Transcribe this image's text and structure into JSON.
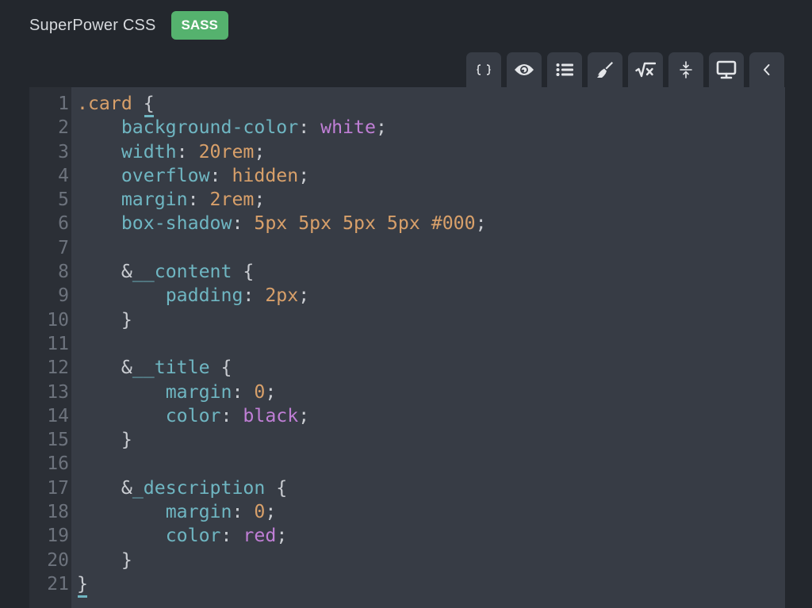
{
  "header": {
    "title": "SuperPower CSS",
    "badge": "SASS"
  },
  "colors": {
    "badge": "#55b26e",
    "property": "#6fb6c2",
    "value": "#d8a06a",
    "keyword": "#c07fd6",
    "background": "#23272d",
    "editor": "#373c45"
  },
  "toolbar": {
    "buttons": [
      {
        "icon": "braces-icon",
        "label": "Format"
      },
      {
        "icon": "eye-icon",
        "label": "Preview"
      },
      {
        "icon": "list-icon",
        "label": "List"
      },
      {
        "icon": "broom-icon",
        "label": "Clean"
      },
      {
        "icon": "square-root-icon",
        "label": "Math"
      },
      {
        "icon": "compress-icon",
        "label": "Collapse"
      },
      {
        "icon": "monitor-icon",
        "label": "Display"
      },
      {
        "icon": "chevron-left-icon",
        "label": "Collapse panel"
      }
    ]
  },
  "editor": {
    "language": "SASS",
    "lines": [
      [
        {
          "t": ".card ",
          "c": "sel"
        },
        {
          "t": "{",
          "c": "punc match"
        }
      ],
      [
        {
          "t": "    "
        },
        {
          "t": "background-color",
          "c": "prop"
        },
        {
          "t": ": ",
          "c": "punc"
        },
        {
          "t": "white",
          "c": "kw"
        },
        {
          "t": ";",
          "c": "punc"
        }
      ],
      [
        {
          "t": "    "
        },
        {
          "t": "width",
          "c": "prop"
        },
        {
          "t": ": ",
          "c": "punc"
        },
        {
          "t": "20rem",
          "c": "num"
        },
        {
          "t": ";",
          "c": "punc"
        }
      ],
      [
        {
          "t": "    "
        },
        {
          "t": "overflow",
          "c": "prop"
        },
        {
          "t": ": ",
          "c": "punc"
        },
        {
          "t": "hidden",
          "c": "num"
        },
        {
          "t": ";",
          "c": "punc"
        }
      ],
      [
        {
          "t": "    "
        },
        {
          "t": "margin",
          "c": "prop"
        },
        {
          "t": ": ",
          "c": "punc"
        },
        {
          "t": "2rem",
          "c": "num"
        },
        {
          "t": ";",
          "c": "punc"
        }
      ],
      [
        {
          "t": "    "
        },
        {
          "t": "box-shadow",
          "c": "prop"
        },
        {
          "t": ": ",
          "c": "punc"
        },
        {
          "t": "5px 5px 5px 5px #000",
          "c": "num"
        },
        {
          "t": ";",
          "c": "punc"
        }
      ],
      [],
      [
        {
          "t": "    "
        },
        {
          "t": "&",
          "c": "amp"
        },
        {
          "t": "__content",
          "c": "bem"
        },
        {
          "t": " {",
          "c": "punc"
        }
      ],
      [
        {
          "t": "        "
        },
        {
          "t": "padding",
          "c": "prop"
        },
        {
          "t": ": ",
          "c": "punc"
        },
        {
          "t": "2px",
          "c": "num"
        },
        {
          "t": ";",
          "c": "punc"
        }
      ],
      [
        {
          "t": "    }",
          "c": "punc"
        }
      ],
      [],
      [
        {
          "t": "    "
        },
        {
          "t": "&",
          "c": "amp"
        },
        {
          "t": "__title",
          "c": "bem"
        },
        {
          "t": " {",
          "c": "punc"
        }
      ],
      [
        {
          "t": "        "
        },
        {
          "t": "margin",
          "c": "prop"
        },
        {
          "t": ": ",
          "c": "punc"
        },
        {
          "t": "0",
          "c": "num"
        },
        {
          "t": ";",
          "c": "punc"
        }
      ],
      [
        {
          "t": "        "
        },
        {
          "t": "color",
          "c": "prop"
        },
        {
          "t": ": ",
          "c": "punc"
        },
        {
          "t": "black",
          "c": "kw"
        },
        {
          "t": ";",
          "c": "punc"
        }
      ],
      [
        {
          "t": "    }",
          "c": "punc"
        }
      ],
      [],
      [
        {
          "t": "    "
        },
        {
          "t": "&",
          "c": "amp"
        },
        {
          "t": "_description",
          "c": "bem"
        },
        {
          "t": " {",
          "c": "punc"
        }
      ],
      [
        {
          "t": "        "
        },
        {
          "t": "margin",
          "c": "prop"
        },
        {
          "t": ": ",
          "c": "punc"
        },
        {
          "t": "0",
          "c": "num"
        },
        {
          "t": ";",
          "c": "punc"
        }
      ],
      [
        {
          "t": "        "
        },
        {
          "t": "color",
          "c": "prop"
        },
        {
          "t": ": ",
          "c": "punc"
        },
        {
          "t": "red",
          "c": "kw"
        },
        {
          "t": ";",
          "c": "punc"
        }
      ],
      [
        {
          "t": "    }",
          "c": "punc"
        }
      ],
      [
        {
          "t": "}",
          "c": "punc match"
        }
      ]
    ]
  }
}
